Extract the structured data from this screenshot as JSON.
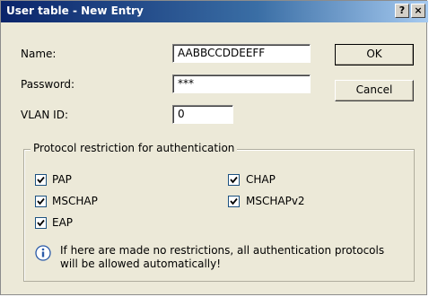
{
  "window": {
    "title": "User table - New Entry",
    "help_glyph": "?",
    "close_glyph": "×"
  },
  "form": {
    "name_label": "Name:",
    "name_value": "AABBCCDDEEFF",
    "password_label": "Password:",
    "password_value": "***",
    "vlan_label": "VLAN ID:",
    "vlan_value": "0"
  },
  "buttons": {
    "ok": "OK",
    "cancel": "Cancel"
  },
  "protocols": {
    "group_label": "Protocol restriction for authentication",
    "items": [
      {
        "label": "PAP",
        "checked": true
      },
      {
        "label": "CHAP",
        "checked": true
      },
      {
        "label": "MSCHAP",
        "checked": true
      },
      {
        "label": "MSCHAPv2",
        "checked": true
      },
      {
        "label": "EAP",
        "checked": true
      }
    ],
    "info_icon": "info-icon",
    "info_text": "If here are made no restrictions, all authentication protocols will be allowed automatically!"
  },
  "colors": {
    "titlebar_start": "#0a246a",
    "titlebar_end": "#a6caf0",
    "dialog_bg": "#ece9d8",
    "checkbox_border": "#1c5180"
  }
}
